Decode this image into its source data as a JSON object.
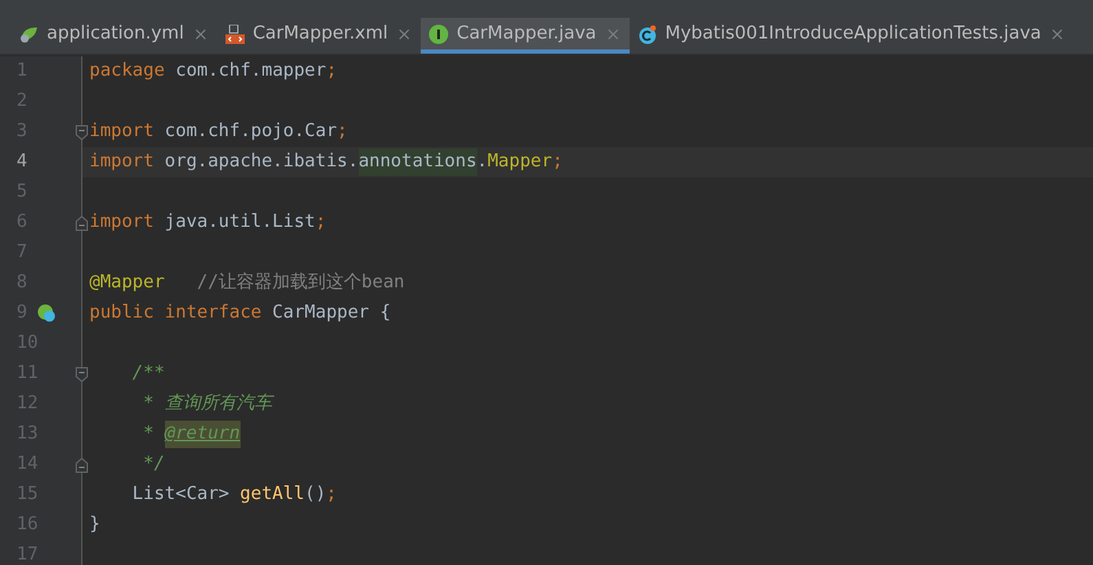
{
  "tabs": [
    {
      "label": "application.yml",
      "kind": "yml",
      "selected": false
    },
    {
      "label": "CarMapper.xml",
      "kind": "xml",
      "selected": false
    },
    {
      "label": "CarMapper.java",
      "kind": "interface",
      "selected": true
    },
    {
      "label": "Mybatis001IntroduceApplicationTests.java",
      "kind": "class",
      "selected": false
    }
  ],
  "lines": [
    {
      "number": "1",
      "current": false,
      "fold_start": false,
      "fold_end": false,
      "gutter_icon": false,
      "tokens": [
        {
          "text": "package",
          "kind": "keyword"
        },
        {
          "text": " com.chf.mapper",
          "kind": "plain"
        },
        {
          "text": ";",
          "kind": "keyword"
        }
      ]
    },
    {
      "number": "2",
      "current": false,
      "fold_start": false,
      "fold_end": false,
      "gutter_icon": false
    },
    {
      "number": "3",
      "current": false,
      "fold_start": true,
      "fold_end": false,
      "gutter_icon": false,
      "tokens": [
        {
          "text": "import",
          "kind": "keyword"
        },
        {
          "text": " com.chf.pojo.Car",
          "kind": "plain"
        },
        {
          "text": ";",
          "kind": "keyword"
        }
      ]
    },
    {
      "number": "4",
      "current": true,
      "fold_start": false,
      "fold_end": false,
      "gutter_icon": false,
      "tokens": [
        {
          "text": "import",
          "kind": "keyword"
        },
        {
          "text": " org.apache.ibatis.",
          "kind": "plain"
        },
        {
          "text": "annotations",
          "kind": "highlighted"
        },
        {
          "text": ".",
          "kind": "plain"
        },
        {
          "text": "Mapper",
          "kind": "annotation"
        },
        {
          "text": ";",
          "kind": "keyword"
        }
      ]
    },
    {
      "number": "5",
      "current": false,
      "fold_start": false,
      "fold_end": false,
      "gutter_icon": false
    },
    {
      "number": "6",
      "current": false,
      "fold_start": false,
      "fold_end": true,
      "gutter_icon": false,
      "tokens": [
        {
          "text": "import",
          "kind": "keyword"
        },
        {
          "text": " java.util.List",
          "kind": "plain"
        },
        {
          "text": ";",
          "kind": "keyword"
        }
      ]
    },
    {
      "number": "7",
      "current": false,
      "fold_start": false,
      "fold_end": false,
      "gutter_icon": false
    },
    {
      "number": "8",
      "current": false,
      "fold_start": false,
      "fold_end": false,
      "gutter_icon": false,
      "tokens": [
        {
          "text": "@Mapper",
          "kind": "annotation"
        },
        {
          "text": "   //让容器加载到这个bean",
          "kind": "comment"
        }
      ]
    },
    {
      "number": "9",
      "current": false,
      "fold_start": false,
      "fold_end": false,
      "gutter_icon": true,
      "tokens": [
        {
          "text": "public interface",
          "kind": "keyword"
        },
        {
          "text": " CarMapper {",
          "kind": "plain"
        }
      ]
    },
    {
      "number": "10",
      "current": false,
      "fold_start": false,
      "fold_end": false,
      "gutter_icon": false
    },
    {
      "number": "11",
      "current": false,
      "fold_start": true,
      "fold_end": false,
      "gutter_icon": false,
      "tokens": [
        {
          "text": "    /**",
          "kind": "doc"
        }
      ]
    },
    {
      "number": "12",
      "current": false,
      "fold_start": false,
      "fold_end": false,
      "gutter_icon": false,
      "tokens": [
        {
          "text": "     * 查询所有汽车",
          "kind": "doc"
        }
      ]
    },
    {
      "number": "13",
      "current": false,
      "fold_start": false,
      "fold_end": false,
      "gutter_icon": false,
      "tokens": [
        {
          "text": "     *",
          "kind": "doc"
        },
        {
          "text": "@return",
          "kind": "doctag"
        }
      ]
    },
    {
      "number": "14",
      "current": false,
      "fold_start": false,
      "fold_end": true,
      "gutter_icon": false,
      "tokens": [
        {
          "text": "     */",
          "kind": "doc"
        }
      ]
    },
    {
      "number": "15",
      "current": false,
      "fold_start": false,
      "fold_end": false,
      "gutter_icon": false,
      "tokens": [
        {
          "text": "    List<Car>",
          "kind": "plain"
        },
        {
          "text": "getAll",
          "kind": "method"
        },
        {
          "text": "()",
          "kind": "plain"
        },
        {
          "text": ";",
          "kind": "keyword"
        }
      ]
    },
    {
      "number": "16",
      "current": false,
      "fold_start": false,
      "fold_end": false,
      "gutter_icon": false,
      "tokens": [
        {
          "text": "}",
          "kind": "plain"
        }
      ]
    },
    {
      "number": "17",
      "current": false,
      "fold_start": false,
      "fold_end": false,
      "gutter_icon": false
    }
  ]
}
